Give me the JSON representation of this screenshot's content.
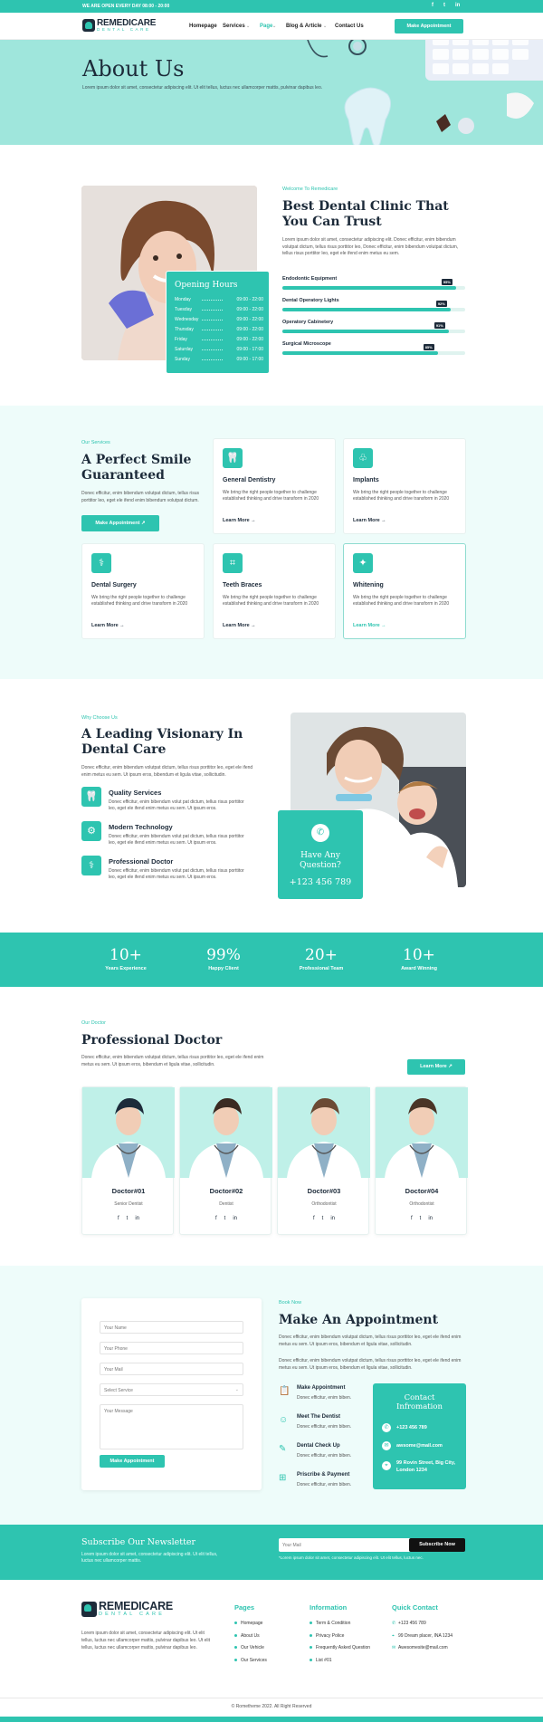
{
  "topbar": {
    "message": "WE ARE OPEN EVERY DAY 08:00 - 20:00",
    "social": [
      "f",
      "t",
      "in"
    ]
  },
  "brand": {
    "name": "REMEDICARE",
    "tagline": "DENTAL CARE"
  },
  "nav": {
    "items": [
      "Homepage",
      "Services",
      "Page",
      "Blog & Article",
      "Contact Us"
    ],
    "cta": "Make Appointment"
  },
  "hero": {
    "title": "About Us",
    "text": "Lorem ipsum dolor sit amet, consectetur adipiscing elit. Ut elit tellus, luctus nec ullamcorper mattis, pulvinar dapibus leo."
  },
  "about": {
    "eyebrow": "Welcome To Remedicare",
    "title": "Best Dental Clinic That You Can Trust",
    "text": "Lorem ipsum dolor sit amet, consectetur adipiscing elit. Donec efficitur, enim bibendum volutpat dictum, tellus risus porttitor leo, Donec efficitur, enim bibendum volutpat dictum, tellus risus porttitor leo, eget ele ifend enim metus eu sem.",
    "hours_title": "Opening Hours",
    "hours": [
      {
        "day": "Monday",
        "time": "09:00 - 22:00"
      },
      {
        "day": "Tuesday",
        "time": "09:00 - 22:00"
      },
      {
        "day": "Wednesday",
        "time": "09:00 - 22:00"
      },
      {
        "day": "Thursday",
        "time": "09:00 - 22:00"
      },
      {
        "day": "Friday",
        "time": "09:00 - 22:00"
      },
      {
        "day": "Saturday",
        "time": "09:00 - 17:00"
      },
      {
        "day": "Sunday",
        "time": "09:00 - 17:00"
      }
    ],
    "skills": [
      {
        "label": "Endodontic Equipment",
        "value": 95,
        "text": "95%"
      },
      {
        "label": "Dental Operatory Lights",
        "value": 92,
        "text": "92%"
      },
      {
        "label": "Operatory Cabinetery",
        "value": 91,
        "text": "91%"
      },
      {
        "label": "Surgical Microscope",
        "value": 85,
        "text": "85%"
      }
    ]
  },
  "services": {
    "eyebrow": "Our Services",
    "title": "A Perfect Smile Guaranteed",
    "text": "Donec efficitur, enim bibendum volutpat dictum, tellus risus porttitor leo, eget ele ifend enim bibendum volutpat dictum.",
    "cta": "Make Appointment",
    "items": [
      {
        "title": "General Dentistry",
        "text": "We bring the right people together to challenge established thinking and drive transform in 2020",
        "link": "Learn More →"
      },
      {
        "title": "Implants",
        "text": "We bring the right people together to challenge established thinking and drive transform in 2020",
        "link": "Learn More →"
      },
      {
        "title": "Dental Surgery",
        "text": "We bring the right people together to challenge established thinking and drive transform in 2020",
        "link": "Learn More →"
      },
      {
        "title": "Teeth Braces",
        "text": "We bring the right people together to challenge established thinking and drive transform in 2020",
        "link": "Learn More →"
      },
      {
        "title": "Whitening",
        "text": "We bring the right people together to challenge established thinking and drive transform in 2020",
        "link": "Learn More →"
      }
    ]
  },
  "why": {
    "eyebrow": "Why Choose Us",
    "title": "A Leading Visionary In Dental Care",
    "text": "Donec efficitur, enim bibendum volutpat dictum, tellus risus porttitor leo, eget ele ifend enim metus eu sem. Ut ipsum eros, bibendum et ligula vitae, sollicitudin.",
    "features": [
      {
        "title": "Quality Services",
        "text": "Donec efficitur, enim bibendum volut pat dictum, tellus risus porttitor leo, eget ele ifend enim metus eu sem. Ut ipsum eros."
      },
      {
        "title": "Modern Technology",
        "text": "Donec efficitur, enim bibendum volut pat dictum, tellus risus porttitor leo, eget ele ifend enim metus eu sem. Ut ipsum eros."
      },
      {
        "title": "Professional Doctor",
        "text": "Donec efficitur, enim bibendum volut pat dictum, tellus risus porttitor leo, eget ele ifend enim metus eu sem. Ut ipsum eros."
      }
    ],
    "question": "Have Any Question?",
    "phone": "+123 456 789"
  },
  "stats": [
    {
      "value": "10+",
      "label": "Years Experience"
    },
    {
      "value": "99%",
      "label": "Happy Client"
    },
    {
      "value": "20+",
      "label": "Professional Team"
    },
    {
      "value": "10+",
      "label": "Award Winning"
    }
  ],
  "doctors": {
    "eyebrow": "Our Doctor",
    "title": "Professional Doctor",
    "text": "Donec efficitur, enim bibendum volutpat dictum, tellus risus porttitor leo, eget ele ifend enim metus eu sem. Ut ipsum eros, bibendum et ligula vitae, sollicitudin.",
    "cta": "Learn More",
    "items": [
      {
        "name": "Doctor#01",
        "role": "Senior Dentist"
      },
      {
        "name": "Doctor#02",
        "role": "Dentist"
      },
      {
        "name": "Doctor#03",
        "role": "Orthodontist"
      },
      {
        "name": "Doctor#04",
        "role": "Orthodontist"
      }
    ]
  },
  "appointment": {
    "eyebrow": "Book Now",
    "title": "Make An Appointment",
    "text1": "Donec efficitur, enim bibendum volutpat dictum, tellus risus porttitor leo, eget ele ifend enim metus eu sem. Ut ipsum eros, bibendum et ligula vitae, sollicitudin.",
    "text2": "Donec efficitur, enim bibendum volutpat dictum, tellus risus porttitor leo, eget ele ifend enim metus eu sem. Ut ipsum eros, bibendum et ligula vitae, sollicitudin.",
    "form": {
      "name": "Your Name",
      "phone": "Your Phone",
      "mail": "Your Mail",
      "service": "Select Service",
      "message": "Your Message",
      "submit": "Make Appointment"
    },
    "steps": [
      {
        "title": "Make Appointment",
        "text": "Donec efficitur, enim biben."
      },
      {
        "title": "Meet The Dentist",
        "text": "Donec efficitur, enim biben."
      },
      {
        "title": "Dental Check Up",
        "text": "Donec efficitur, enim biben."
      },
      {
        "title": "Priscribe & Payment",
        "text": "Donec efficitur, enim biben."
      }
    ],
    "contact": {
      "title": "Contact Infromation",
      "phone": "+123 456 789",
      "email": "awsome@mail.com",
      "address": "99 Rovin Street, Big City, London 1234"
    }
  },
  "newsletter": {
    "title": "Subscribe Our Newsletter",
    "text": "Lorem ipsum dolor sit amet, consectetur adipiscing elit. Ut elit tellus, luctus nec ullamcorper mattis.",
    "placeholder": "Your Mail",
    "button": "Subscribe Now",
    "note": "*Lorem ipsum dolor sit amet, consectetur adipiscing elit. Ut elit tellus, luctus nec."
  },
  "footer": {
    "about": "Lorem ipsum dolor sit amet, consectetur adipiscing elit. Ut elit tellus, luctus nec ullamcorper mattis, pulvinar dapibus leo. Ut elit tellus, luctus nec ullamcorper mattis, pulvinar dapibus leo.",
    "pages_title": "Pages",
    "pages": [
      "Homepage",
      "About Us",
      "Our Vehicle",
      "Our Services"
    ],
    "info_title": "Information",
    "info": [
      "Term & Condition",
      "Privacy Police",
      "Frequently Asked Question",
      "List #01"
    ],
    "contact_title": "Quick Contact",
    "contact": [
      "+123 456 789",
      "99 Dream placer, INA 1234",
      "Awesomesite@mail.com"
    ],
    "copyright": "© Rometheme 2022. All Right Reserved"
  }
}
